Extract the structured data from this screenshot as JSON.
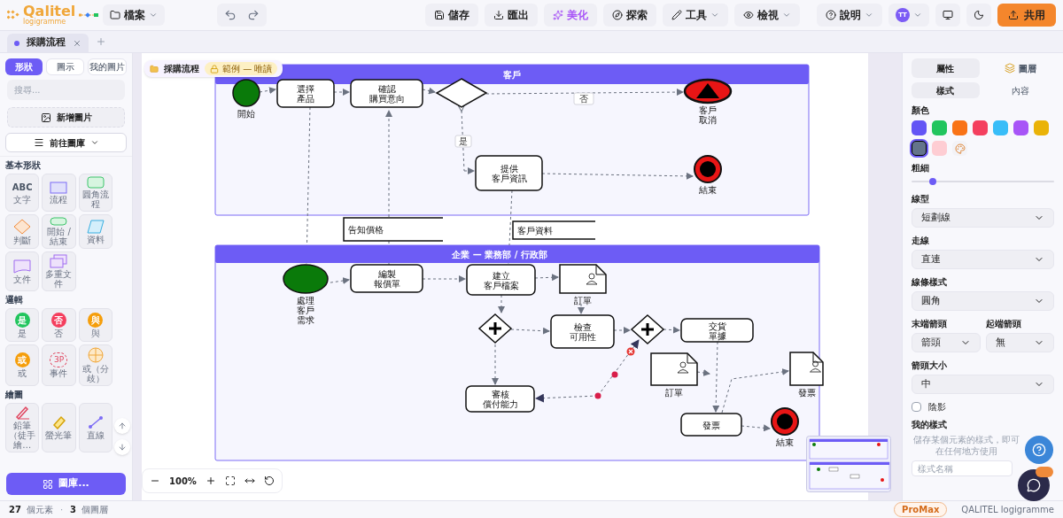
{
  "app": {
    "name": "Qalitel",
    "subtitle": "logigramme"
  },
  "toolbar": {
    "file_menu": "檔案",
    "actions": [
      {
        "label": "儲存",
        "kind": "plain"
      },
      {
        "label": "匯出",
        "kind": "plain"
      },
      {
        "label": "美化",
        "kind": "accent"
      },
      {
        "label": "探索",
        "kind": "plain"
      },
      {
        "label": "工具",
        "kind": "menu"
      },
      {
        "label": "檢視",
        "kind": "menu"
      }
    ],
    "help": "說明",
    "avatar": "TT",
    "share": "共用"
  },
  "doc_tabs": [
    {
      "label": "採購流程",
      "selected": true
    }
  ],
  "left_panel": {
    "tabs": [
      {
        "label": "形狀",
        "selected": true
      },
      {
        "label": "圖示",
        "selected": false
      },
      {
        "label": "我的圖片",
        "selected": false
      }
    ],
    "search": {
      "placeholder": "搜尋..."
    },
    "add_image": "新增圖片",
    "go_library": "前往圖庫",
    "sections": [
      {
        "title": "基本形狀",
        "items": [
          {
            "kind": "text",
            "label": "文字",
            "glyph": "ABC"
          },
          {
            "kind": "rect",
            "label": "流程"
          },
          {
            "kind": "round",
            "label": "圓角流程"
          },
          {
            "kind": "diamond",
            "label": "判斷"
          },
          {
            "kind": "pill",
            "label": "開始 / 結束"
          },
          {
            "kind": "para",
            "label": "資料"
          },
          {
            "kind": "doc",
            "label": "文件"
          },
          {
            "kind": "multidoc",
            "label": "多重文件"
          }
        ]
      },
      {
        "title": "邏輯",
        "items": [
          {
            "kind": "badge",
            "label": "是",
            "glyph": "是",
            "color": "#22c55e"
          },
          {
            "kind": "badge",
            "label": "否",
            "glyph": "否",
            "color": "#f43f5e"
          },
          {
            "kind": "badge",
            "label": "與",
            "glyph": "與",
            "color": "#f59e0b"
          },
          {
            "kind": "badge",
            "label": "或",
            "glyph": "或",
            "color": "#f59e0b"
          },
          {
            "kind": "event",
            "label": "事件",
            "glyph": "3P"
          },
          {
            "kind": "cross",
            "label": "或（分歧）"
          }
        ]
      },
      {
        "title": "繪圖",
        "items": [
          {
            "kind": "pen",
            "label": "鉛筆（徒手繪…"
          },
          {
            "kind": "marker",
            "label": "螢光筆"
          },
          {
            "kind": "line",
            "label": "直線"
          }
        ]
      }
    ],
    "library_button": "圖庫..."
  },
  "breadcrumb": {
    "title": "採購流程",
    "badge": "範例 — 唯讀"
  },
  "lanes": [
    {
      "title": "客戶"
    },
    {
      "title": "企業 — 業務部 / 行政部"
    }
  ],
  "nodes": [
    {
      "kind": "start",
      "lines": [
        "開始"
      ]
    },
    {
      "kind": "task",
      "lines": [
        "選擇",
        "產品"
      ]
    },
    {
      "kind": "task",
      "lines": [
        "確認",
        "購買意向"
      ]
    },
    {
      "kind": "gateway"
    },
    {
      "kind": "cancel",
      "lines": [
        "客戶",
        "取消"
      ]
    },
    {
      "kind": "task",
      "lines": [
        "提供",
        "客戶資訊"
      ]
    },
    {
      "kind": "end",
      "lines": [
        "結束"
      ]
    },
    {
      "kind": "data",
      "lines": [
        "告知價格"
      ]
    },
    {
      "kind": "data",
      "lines": [
        "客戶資料"
      ]
    },
    {
      "kind": "start_ellipse",
      "lines": [
        "處理",
        "客戶",
        "需求"
      ]
    },
    {
      "kind": "task",
      "lines": [
        "編製",
        "報價單"
      ]
    },
    {
      "kind": "task",
      "lines": [
        "建立",
        "客戶檔案"
      ]
    },
    {
      "kind": "doc",
      "lines": [
        "訂單"
      ]
    },
    {
      "kind": "parallel"
    },
    {
      "kind": "task",
      "lines": [
        "檢查",
        "可用性"
      ]
    },
    {
      "kind": "parallel"
    },
    {
      "kind": "task",
      "lines": [
        "交貨",
        "單據"
      ]
    },
    {
      "kind": "task",
      "lines": [
        "審核",
        "償付能力"
      ]
    },
    {
      "kind": "doc",
      "lines": [
        "訂單"
      ]
    },
    {
      "kind": "doc",
      "lines": [
        "發票"
      ]
    },
    {
      "kind": "task",
      "lines": [
        "發票"
      ]
    },
    {
      "kind": "end",
      "lines": [
        "結束"
      ]
    }
  ],
  "edge_labels": [
    "否",
    "是"
  ],
  "zoom": "100%",
  "right_panel": {
    "tabs": [
      {
        "label": "屬性",
        "selected": true
      },
      {
        "label": "圖層",
        "selected": false
      }
    ],
    "subtabs": [
      {
        "label": "樣式",
        "selected": true
      },
      {
        "label": "內容",
        "selected": false
      }
    ],
    "color_label": "顏色",
    "colors": [
      {
        "color": "#6355f5",
        "selected": false
      },
      {
        "color": "#22c55e",
        "selected": false
      },
      {
        "color": "#f97316",
        "selected": false
      },
      {
        "color": "#f43f5e",
        "selected": false
      },
      {
        "color": "#38bdf8",
        "selected": false
      },
      {
        "color": "#a855f7",
        "selected": false
      },
      {
        "color": "#eab308",
        "selected": false
      },
      {
        "color": "#64748b",
        "selected": true
      },
      {
        "color": "#fecdd3",
        "selected": false
      }
    ],
    "width_label": "粗細",
    "width": {
      "level": 0.15
    },
    "fields": [
      {
        "label": "線型",
        "value": "短劃線"
      },
      {
        "label": "走線",
        "value": "直連"
      },
      {
        "label": "線條樣式",
        "value": "圓角"
      }
    ],
    "arrow_fields": [
      {
        "label": "末端箭頭",
        "value": "箭頭"
      },
      {
        "label": "起端箭頭",
        "value": "無"
      }
    ],
    "size_field": {
      "label": "箭頭大小",
      "value": "中"
    },
    "shadow": {
      "label": "陰影",
      "checked": false
    },
    "my_styles": {
      "title": "我的樣式",
      "hint": "儲存某個元素的樣式，即可在任何地方使用",
      "placeholder": "樣式名稱"
    }
  },
  "status_bar": {
    "counts": [
      {
        "count": "27",
        "label": "個元素"
      },
      {
        "count": "3",
        "label": "個圖層"
      }
    ],
    "separator": "·",
    "plan": "ProMax",
    "product": "QALITEL logigramme"
  }
}
